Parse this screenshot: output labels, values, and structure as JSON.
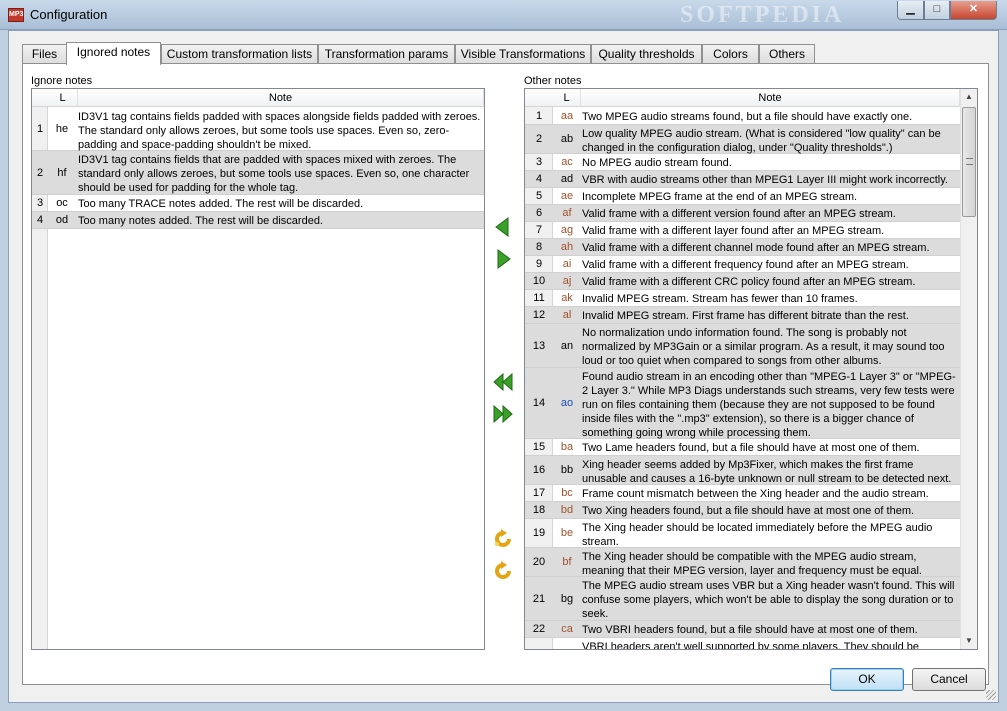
{
  "window": {
    "title": "Configuration",
    "app_icon_text": "MP3",
    "watermark": "SOFTPEDIA",
    "buttons": {
      "minimize": "▁",
      "maximize": "□",
      "close": "✕"
    }
  },
  "tabs": [
    {
      "label": "Files",
      "active": false
    },
    {
      "label": "Ignored notes",
      "active": true
    },
    {
      "label": "Custom transformation lists",
      "active": false
    },
    {
      "label": "Transformation params",
      "active": false
    },
    {
      "label": "Visible Transformations",
      "active": false
    },
    {
      "label": "Quality thresholds",
      "active": false
    },
    {
      "label": "Colors",
      "active": false
    },
    {
      "label": "Others",
      "active": false
    }
  ],
  "ignore": {
    "label": "Ignore notes",
    "header": {
      "level": "L",
      "note": "Note"
    },
    "rows": [
      {
        "num": "1",
        "code": "he",
        "note": "ID3V1 tag contains fields padded with spaces alongside fields padded with zeroes. The standard only allows zeroes, but some tools use spaces. Even so, zero-padding and space-padding shouldn't be mixed."
      },
      {
        "num": "2",
        "code": "hf",
        "note": "ID3V1 tag contains fields that are padded with spaces mixed with zeroes. The standard only allows zeroes, but some tools use spaces. Even so, one character should be used for padding for the whole tag."
      },
      {
        "num": "3",
        "code": "oc",
        "note": "Too many TRACE notes added. The rest will be discarded."
      },
      {
        "num": "4",
        "code": "od",
        "note": "Too many notes added. The rest will be discarded."
      }
    ]
  },
  "other": {
    "label": "Other notes",
    "header": {
      "level": "L",
      "note": "Note"
    },
    "rows": [
      {
        "num": "1",
        "code": "aa",
        "note": "Two MPEG audio streams found, but a file should have exactly one."
      },
      {
        "num": "2",
        "code": "ab",
        "note": "Low quality MPEG audio stream. (What is considered \"low quality\" can be changed in the configuration dialog, under \"Quality thresholds\".)"
      },
      {
        "num": "3",
        "code": "ac",
        "note": "No MPEG audio stream found."
      },
      {
        "num": "4",
        "code": "ad",
        "note": "VBR with audio streams other than MPEG1 Layer III might work incorrectly."
      },
      {
        "num": "5",
        "code": "ae",
        "note": "Incomplete MPEG frame at the end of an MPEG stream."
      },
      {
        "num": "6",
        "code": "af",
        "note": "Valid frame with a different version found after an MPEG stream."
      },
      {
        "num": "7",
        "code": "ag",
        "note": "Valid frame with a different layer found after an MPEG stream."
      },
      {
        "num": "8",
        "code": "ah",
        "note": "Valid frame with a different channel mode found after an MPEG stream."
      },
      {
        "num": "9",
        "code": "ai",
        "note": "Valid frame with a different frequency found after an MPEG stream."
      },
      {
        "num": "10",
        "code": "aj",
        "note": "Valid frame with a different CRC policy found after an MPEG stream."
      },
      {
        "num": "11",
        "code": "ak",
        "note": "Invalid MPEG stream. Stream has fewer than 10 frames."
      },
      {
        "num": "12",
        "code": "al",
        "note": "Invalid MPEG stream. First frame has different bitrate than the rest."
      },
      {
        "num": "13",
        "code": "an",
        "note": "No normalization undo information found. The song is probably not normalized by MP3Gain or a similar program. As a result, it may sound too loud or too quiet when compared to songs from other albums."
      },
      {
        "num": "14",
        "code": "ao",
        "note": "Found audio stream in an encoding other than \"MPEG-1 Layer 3\" or \"MPEG-2 Layer 3.\" While MP3 Diags understands such streams, very few tests were run on files containing them (because they are not supposed to be found inside files with the \".mp3\" extension), so there is a bigger chance of something going wrong while processing them."
      },
      {
        "num": "15",
        "code": "ba",
        "note": "Two Lame headers found, but a file should have at most one of them."
      },
      {
        "num": "16",
        "code": "bb",
        "note": "Xing header seems added by Mp3Fixer, which makes the first frame unusable and causes a 16-byte unknown or null stream to be detected next."
      },
      {
        "num": "17",
        "code": "bc",
        "note": "Frame count mismatch between the Xing header and the audio stream."
      },
      {
        "num": "18",
        "code": "bd",
        "note": "Two Xing headers found, but a file should have at most one of them."
      },
      {
        "num": "19",
        "code": "be",
        "note": "The Xing header should be located immediately before the MPEG audio stream."
      },
      {
        "num": "20",
        "code": "bf",
        "note": "The Xing header should be compatible with the MPEG audio stream, meaning that their MPEG version, layer and frequency must be equal."
      },
      {
        "num": "21",
        "code": "bg",
        "note": "The MPEG audio stream uses VBR but a Xing header wasn't found. This will confuse some players, which won't be able to display the song duration or to seek."
      },
      {
        "num": "22",
        "code": "ca",
        "note": "Two VBRI headers found, but a file should have at most one of them."
      },
      {
        "num": "",
        "code": "",
        "note": "VBRI headers aren't well supported by some players. They should be"
      }
    ]
  },
  "colors": {
    "code_error": "#a0522d",
    "code_info": "#1f4fbf",
    "code_normal": "#000000",
    "selected_row": "#dcdcdc"
  },
  "buttons": {
    "ok": "OK",
    "cancel": "Cancel"
  }
}
